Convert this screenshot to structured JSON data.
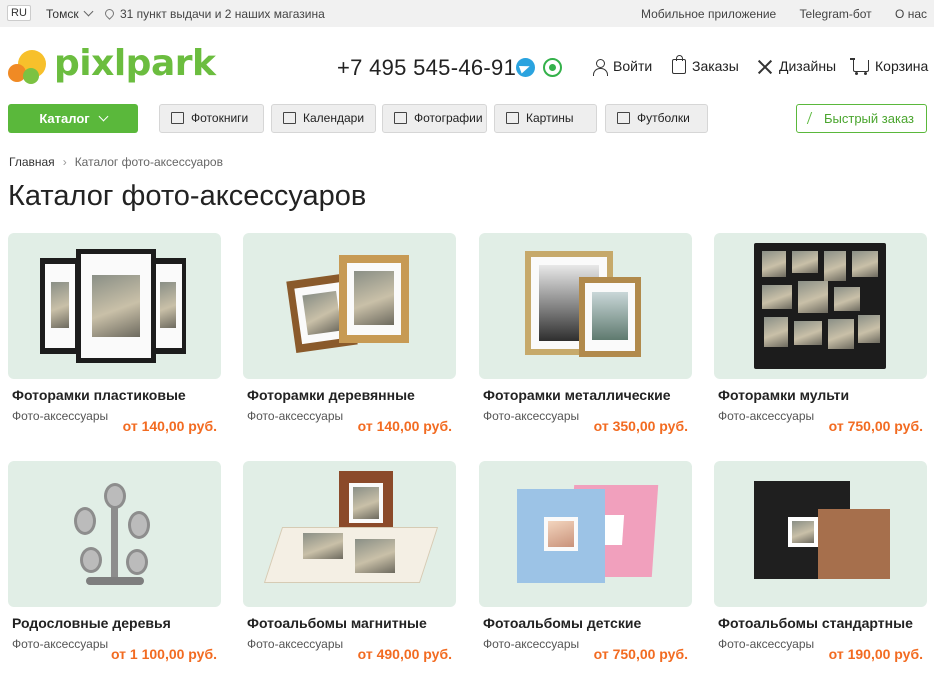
{
  "topbar": {
    "lang": "RU",
    "city": "Томск",
    "pickup": "31 пункт выдачи и 2 наших магазина",
    "links": [
      "Мобильное приложение",
      "Telegram-бот",
      "О нас"
    ]
  },
  "header": {
    "logo": "pixlpark",
    "phone": "+7 495 545-46-91",
    "nav": {
      "login": "Войти",
      "orders": "Заказы",
      "designs": "Дизайны",
      "cart": "Корзина"
    }
  },
  "navbar": {
    "catalog": "Каталог",
    "categories": [
      "Фотокниги",
      "Календари",
      "Фотографии",
      "Картины",
      "Футболки"
    ],
    "fast_order": "Быстрый заказ"
  },
  "breadcrumb": {
    "home": "Главная",
    "separator": "›",
    "current": "Каталог фото-аксессуаров"
  },
  "page_title": "Каталог фото-аксессуаров",
  "products": [
    {
      "name": "Фоторамки пластиковые",
      "category": "Фото-аксессуары",
      "price": "от 140,00 руб."
    },
    {
      "name": "Фоторамки деревянные",
      "category": "Фото-аксессуары",
      "price": "от 140,00 руб."
    },
    {
      "name": "Фоторамки металлические",
      "category": "Фото-аксессуары",
      "price": "от 350,00 руб."
    },
    {
      "name": "Фоторамки мульти",
      "category": "Фото-аксессуары",
      "price": "от 750,00 руб."
    },
    {
      "name": "Родословные деревья",
      "category": "Фото-аксессуары",
      "price": "от 1 100,00 руб."
    },
    {
      "name": "Фотоальбомы магнитные",
      "category": "Фото-аксессуары",
      "price": "от 490,00 руб."
    },
    {
      "name": "Фотоальбомы детские",
      "category": "Фото-аксессуары",
      "price": "от 750,00 руб."
    },
    {
      "name": "Фотоальбомы стандартные",
      "category": "Фото-аксессуары",
      "price": "от 190,00 руб."
    }
  ],
  "colors": {
    "brand_green": "#5ab83b",
    "price_orange": "#f26b21",
    "card_bg": "#e1eee6"
  }
}
